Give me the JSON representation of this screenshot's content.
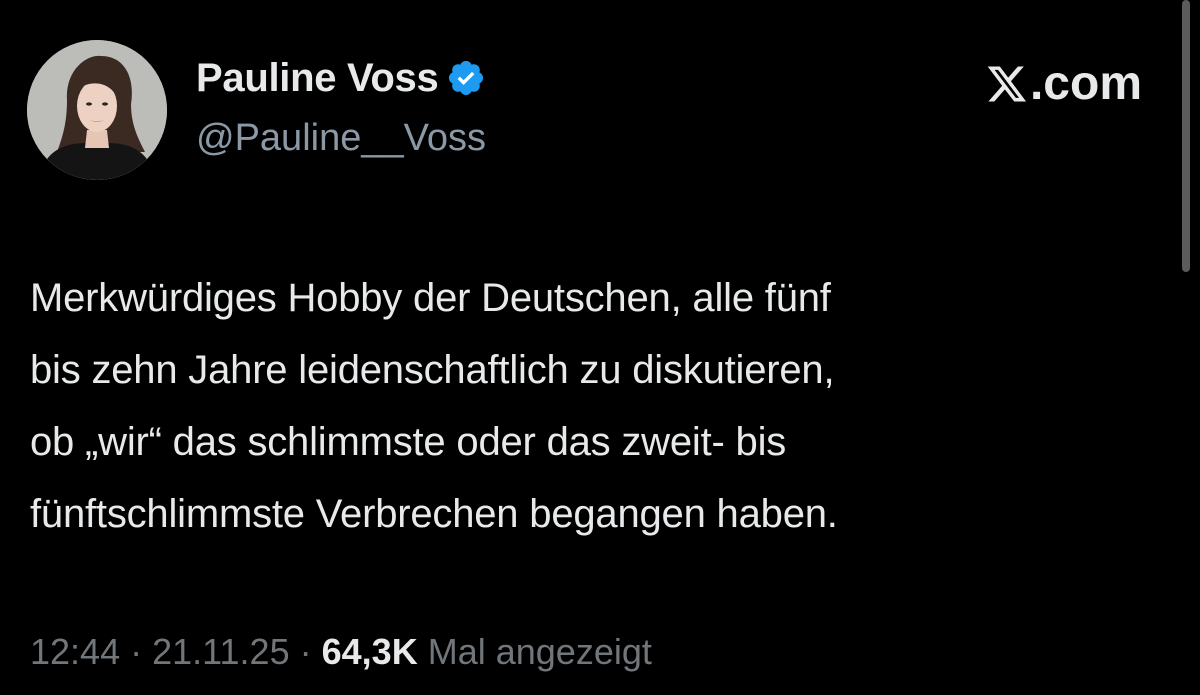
{
  "tweet": {
    "author": {
      "display_name": "Pauline Voss",
      "handle": "@Pauline__Voss",
      "verified": true
    },
    "brand": "X.com",
    "brand_parts": {
      "x": "X",
      "domain": ".com"
    },
    "text_lines": [
      "Merkwürdiges Hobby der Deutschen, alle fünf",
      "bis zehn Jahre leidenschaftlich zu diskutieren,",
      "ob „wir“ das schlimmste oder das zweit- bis",
      "fünftschlimmste Verbrechen begangen haben."
    ],
    "meta": {
      "time": "12:44",
      "separator": "·",
      "date": "21.11.25",
      "views_count": "64,3K",
      "views_label": "Mal angezeigt"
    }
  },
  "icons": {
    "verified": "verified-badge-icon",
    "brand": "x-logo-icon"
  },
  "colors": {
    "background": "#000000",
    "text_primary": "#e7e9ea",
    "text_secondary": "#71767b",
    "verified_blue": "#1d9bf0"
  }
}
